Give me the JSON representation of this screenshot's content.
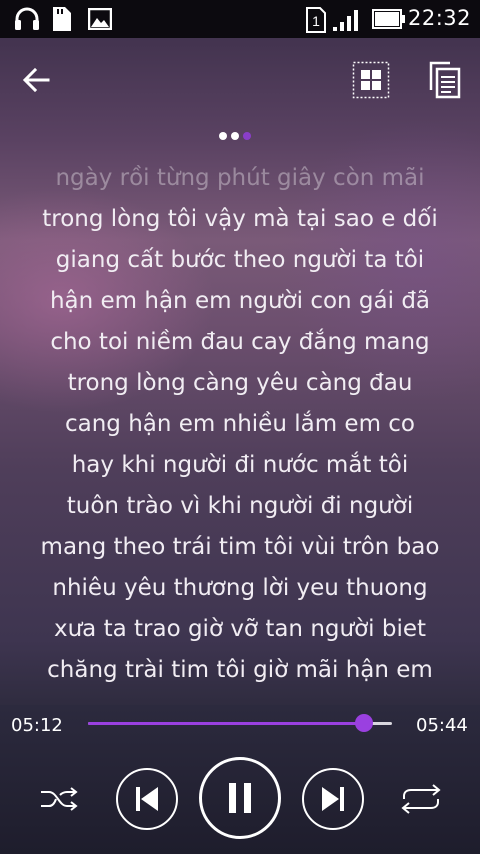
{
  "status_bar": {
    "time": "22:32",
    "sim_slot": "1",
    "icons": [
      "headphones-icon",
      "sd-card-icon",
      "image-icon",
      "sim-icon",
      "signal-icon",
      "battery-icon"
    ]
  },
  "top_bar": {
    "icons": [
      "back-arrow-icon",
      "grid-view-icon",
      "copy-lyrics-icon"
    ]
  },
  "page_indicator": {
    "count": 3,
    "active_index": 2
  },
  "lyrics": [
    "ngày rồi từng phút giây còn mãi",
    "trong lòng tôi vậy mà tại sao e dối",
    "giang cất bước theo người ta tôi",
    "hận em hận em người con gái đã",
    "cho toi niềm đau cay đắng mang",
    "trong lòng càng yêu càng đau",
    "cang hận em nhiều lắm em co",
    "hay khi người đi nước mắt tôi",
    "tuôn trào vì khi người đi người",
    "mang theo trái tim tôi vùi trôn bao",
    "nhiêu yêu thương lời yeu thuong",
    "xưa ta trao giờ vỡ tan người biet",
    "chăng trài tim tôi giờ mãi hận em"
  ],
  "player": {
    "elapsed": "05:12",
    "duration": "05:44",
    "progress_fraction": 0.907,
    "accent_color": "#9a40e0",
    "controls": [
      "shuffle-icon",
      "previous-icon",
      "pause-icon",
      "next-icon",
      "repeat-icon"
    ]
  }
}
